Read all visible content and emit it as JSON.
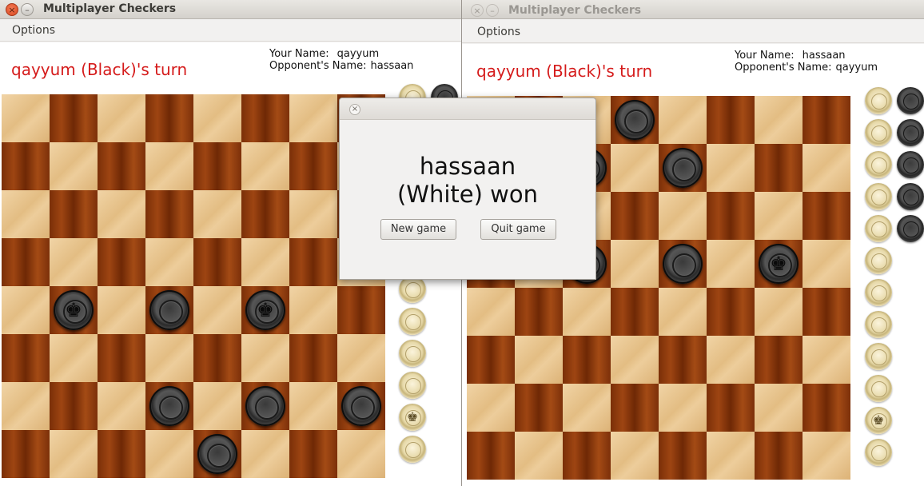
{
  "left_window": {
    "title": "Multiplayer Checkers",
    "close_glyph": "×",
    "minimize_glyph": "–",
    "menu": "Options",
    "turn_text": "qayyum (Black)'s turn",
    "your_name_label": "Your Name:",
    "your_name": "qayyum",
    "opponent_label": "Opponent's Name:",
    "opponent_name": "hassaan",
    "pieces": [
      {
        "row": 4,
        "col": 1,
        "color": "black",
        "king": true
      },
      {
        "row": 4,
        "col": 3,
        "color": "black",
        "king": false
      },
      {
        "row": 4,
        "col": 5,
        "color": "black",
        "king": true
      },
      {
        "row": 6,
        "col": 3,
        "color": "black",
        "king": false
      },
      {
        "row": 6,
        "col": 5,
        "color": "black",
        "king": false
      },
      {
        "row": 6,
        "col": 7,
        "color": "black",
        "king": false
      },
      {
        "row": 7,
        "col": 4,
        "color": "black",
        "king": false
      }
    ]
  },
  "right_window": {
    "title": "Multiplayer Checkers",
    "close_glyph": "×",
    "minimize_glyph": "–",
    "menu": "Options",
    "turn_text": "qayyum (Black)'s turn",
    "your_name_label": "Your Name:",
    "your_name": "hassaan",
    "opponent_label": "Opponent's Name:",
    "opponent_name": "qayyum",
    "pieces": [
      {
        "row": 0,
        "col": 3,
        "color": "black",
        "king": false
      },
      {
        "row": 1,
        "col": 2,
        "color": "black",
        "king": false
      },
      {
        "row": 1,
        "col": 4,
        "color": "black",
        "king": false
      },
      {
        "row": 3,
        "col": 2,
        "color": "black",
        "king": false
      },
      {
        "row": 3,
        "col": 4,
        "color": "black",
        "king": false
      },
      {
        "row": 3,
        "col": 6,
        "color": "black",
        "king": true
      }
    ],
    "captured_white_count": 12,
    "captured_white_king_index": 10,
    "captured_black_count": 5
  },
  "dialog": {
    "close_glyph": "×",
    "message_line1": "hassaan",
    "message_line2": "(White) won",
    "new_game_label": "New game",
    "quit_game_label": "Quit game"
  },
  "icons": {
    "king": "♚",
    "captured_king": "♚"
  },
  "colors": {
    "turn_text": "#d51b1b",
    "light_square": "#e8c590",
    "dark_square": "#8a3a0c",
    "black_piece": "#3a3a3a",
    "white_piece": "#e7d9a9"
  }
}
